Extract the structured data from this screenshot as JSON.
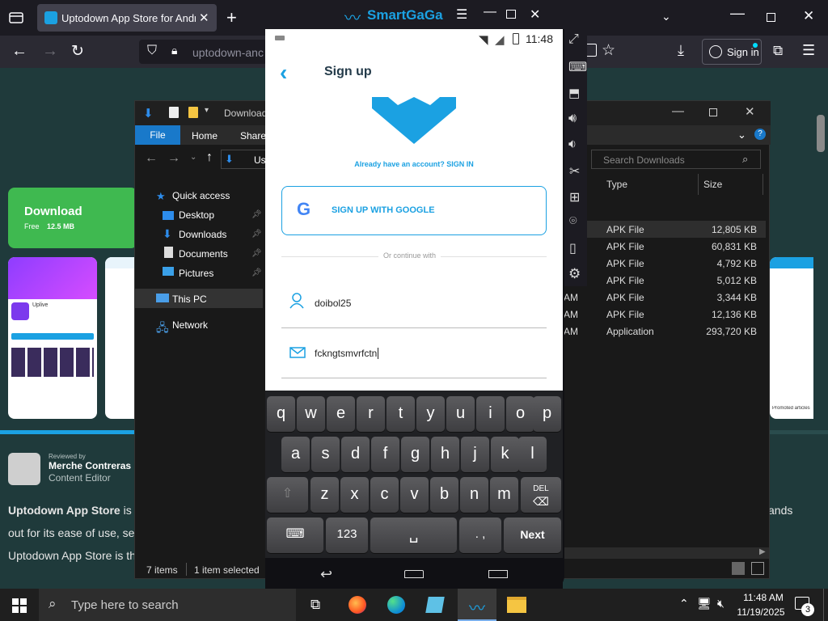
{
  "browser": {
    "tab_title": "Uptodown App Store for Android",
    "url": "uptodown-anc",
    "sign_in": "Sign in"
  },
  "emulator": {
    "brand": "SmartGaGa",
    "status_time": "11:48"
  },
  "phone_screen": {
    "title": "Sign up",
    "already_text": "Already have an account? SIGN IN",
    "google_button": "SIGN UP WITH GOOGLE",
    "divider_text": "Or continue with",
    "username_value": "doibol25",
    "email_value": "fckngtsmvrfctn"
  },
  "keyboard": {
    "row1": [
      "q",
      "w",
      "e",
      "r",
      "t",
      "y",
      "u",
      "i",
      "o",
      "p"
    ],
    "row2": [
      "a",
      "s",
      "d",
      "f",
      "g",
      "h",
      "j",
      "k",
      "l"
    ],
    "row3": [
      "z",
      "x",
      "c",
      "v",
      "b",
      "n",
      "m"
    ],
    "del": "DEL",
    "num": "123",
    "punct": ". ,",
    "next": "Next"
  },
  "page": {
    "download_label": "Download",
    "free_label": "Free",
    "size_label": "12.5 MB",
    "app_name": "Uplive",
    "reviewed_by": "Reviewed by",
    "reviewer_name": "Merche Contreras",
    "reviewer_role": "Content Editor",
    "para_line1_start": "Uptodown App Store",
    "para_line1_rest": " is th",
    "para_line1_end": "ands",
    "para_line2": "out for its ease of use, sec",
    "para_line3": "Uptodown App Store is th",
    "promoted": "Promoted articles"
  },
  "explorer": {
    "title": "Download",
    "ribbon_tabs": [
      "File",
      "Home",
      "Share"
    ],
    "address_partial": "Us",
    "search_placeholder": "Search Downloads",
    "col_type": "Type",
    "col_size": "Size",
    "nav": [
      {
        "label": "Quick access",
        "pinned": false
      },
      {
        "label": "Desktop",
        "pinned": true
      },
      {
        "label": "Downloads",
        "pinned": true
      },
      {
        "label": "Documents",
        "pinned": true
      },
      {
        "label": "Pictures",
        "pinned": true
      },
      {
        "label": "This PC",
        "pinned": false
      },
      {
        "label": "Network",
        "pinned": false
      }
    ],
    "rows": [
      {
        "time": "",
        "type": "APK File",
        "size": "12,805 KB"
      },
      {
        "time": "",
        "type": "APK File",
        "size": "60,831 KB"
      },
      {
        "time": "",
        "type": "APK File",
        "size": "4,792 KB"
      },
      {
        "time": "",
        "type": "APK File",
        "size": "5,012 KB"
      },
      {
        "time": "AM",
        "type": "APK File",
        "size": "3,344 KB"
      },
      {
        "time": "AM",
        "type": "APK File",
        "size": "12,136 KB"
      },
      {
        "time": "AM",
        "type": "Application",
        "size": "293,720 KB"
      }
    ],
    "status_items": "7 items",
    "status_selected": "1 item selected"
  },
  "taskbar": {
    "search_placeholder": "Type here to search",
    "time": "11:48 AM",
    "date": "11/19/2025",
    "notif_count": "3"
  }
}
